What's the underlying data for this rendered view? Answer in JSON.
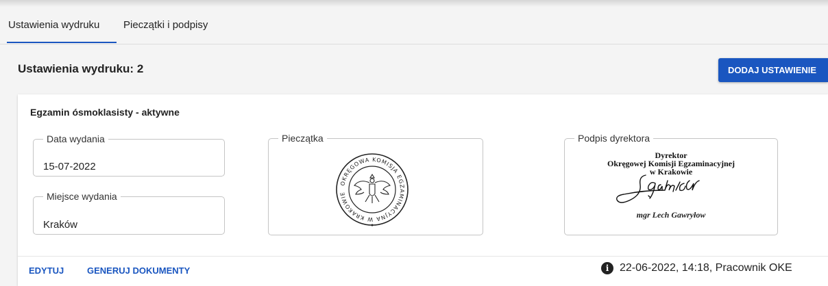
{
  "tabs": [
    {
      "label": "Ustawienia wydruku",
      "active": true
    },
    {
      "label": "Pieczątki i podpisy",
      "active": false
    }
  ],
  "heading": "Ustawienia wydruku: 2",
  "add_button": "DODAJ USTAWIENIE",
  "card": {
    "title": "Egzamin ósmoklasisty - aktywne",
    "date_field": {
      "label": "Data wydania",
      "value": "15-07-2022"
    },
    "place_field": {
      "label": "Miejsce wydania",
      "value": "Kraków"
    },
    "stamp_field": {
      "label": "Pieczątka",
      "stamp_text": "OKRĘGOWA KOMISJA EGZAMINACYJNA W KRAKOWIE"
    },
    "sign_field": {
      "label": "Podpis dyrektora",
      "line1": "Dyrektor",
      "line2": "Okręgowej Komisji Egzaminacyjnej",
      "line3": "w Krakowie",
      "signature": "J. Gawryłow",
      "name": "mgr Lech Gawryłow"
    },
    "edit_link": "EDYTUJ",
    "generate_link": "GENERUJ DOKUMENTY",
    "meta": "22-06-2022, 14:18, Pracownik OKE",
    "info_icon": "info-icon"
  },
  "colors": {
    "accent": "#1a56c0",
    "background": "#f4f4f4"
  }
}
